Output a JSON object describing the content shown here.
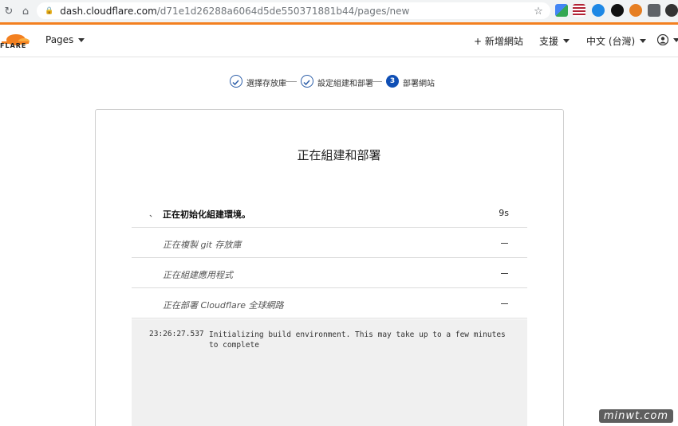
{
  "browser": {
    "url_host": "dash.cloudflare.com",
    "url_path": "/d71e1d26288a6064d5de550371881b44/pages/new"
  },
  "header": {
    "logo_text": "FLARE",
    "pages_menu": "Pages",
    "add_site": "+ 新增網站",
    "support": "支援",
    "language": "中文 (台灣)"
  },
  "steps": [
    {
      "label": "選擇存放庫",
      "state": "done"
    },
    {
      "label": "設定組建和部署",
      "state": "done"
    },
    {
      "label": "部署網站",
      "state": "current",
      "number": "3"
    }
  ],
  "card": {
    "title": "正在組建和部署",
    "rows": [
      {
        "label": "正在初始化組建環境。",
        "value": "9s",
        "state": "active"
      },
      {
        "label": "正在複製 git 存放庫",
        "state": "pending"
      },
      {
        "label": "正在組建應用程式",
        "state": "pending"
      },
      {
        "label": "正在部署 Cloudflare 全球網路",
        "state": "pending"
      }
    ],
    "log": {
      "timestamp": "23:26:27.537",
      "message": "Initializing build environment. This may take up to a few minutes to complete"
    }
  },
  "colors": {
    "accent": "#f38020",
    "step_blue": "#0f4fb5"
  },
  "watermark": "minwt.com"
}
